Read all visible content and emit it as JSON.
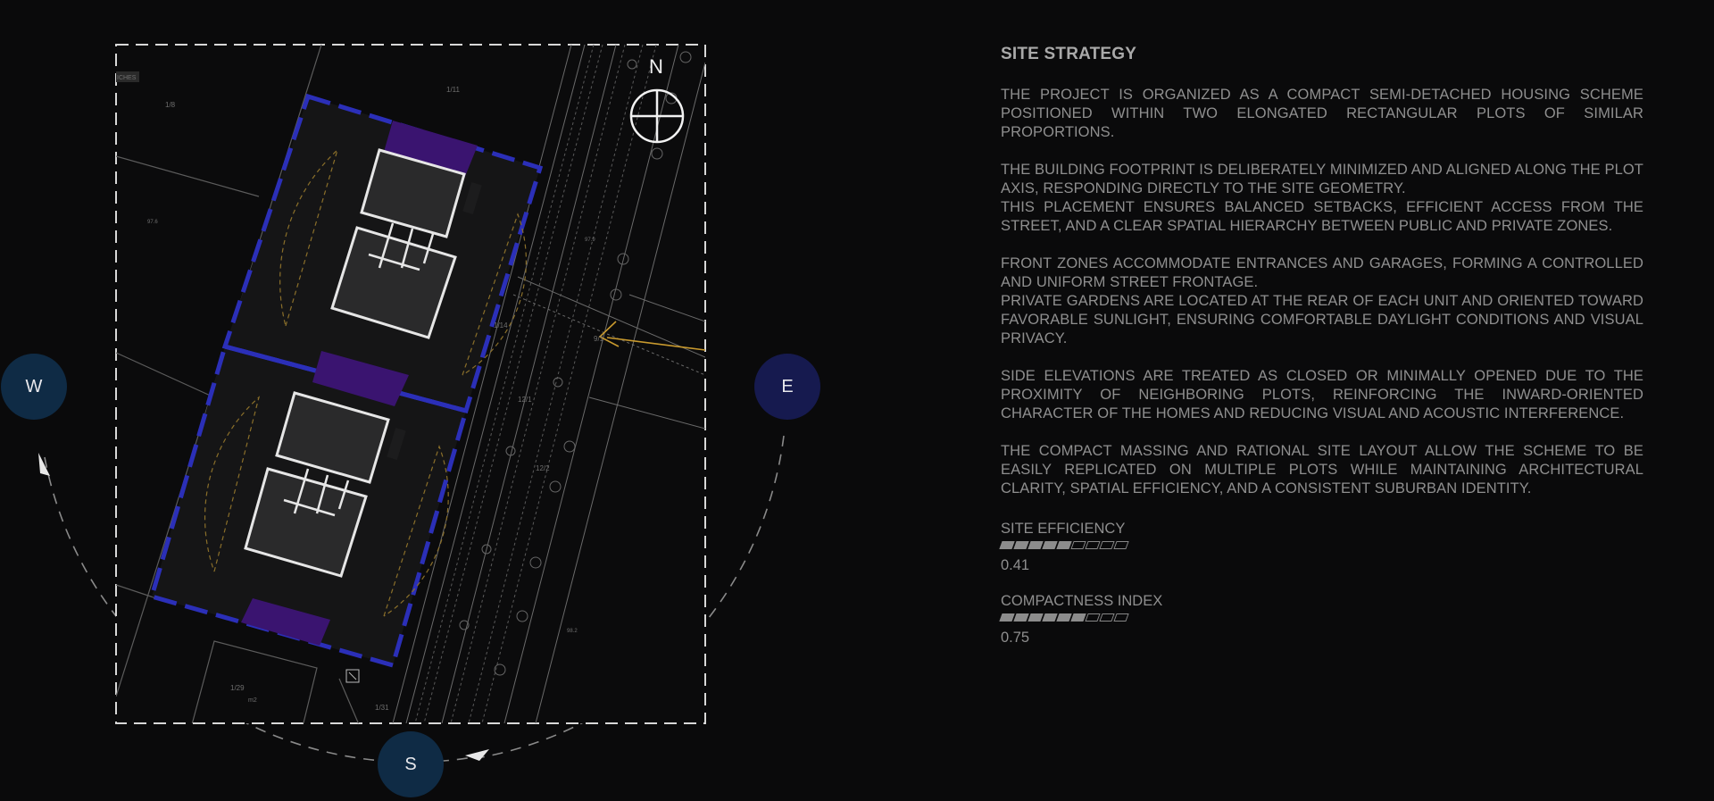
{
  "plan": {
    "north_label": "N",
    "plot_labels": [
      "1/8",
      "1/11",
      "1/14",
      "9/1",
      "12/1",
      "12/2",
      "1/29",
      "1/31"
    ],
    "elevation_labels": [
      "97.6",
      "98.2",
      "97.9"
    ],
    "legend_tag": "ICHES",
    "area_unit": "m2",
    "compass": {
      "west": "W",
      "east": "E",
      "south": "S"
    }
  },
  "panel": {
    "title": "SITE STRATEGY",
    "paragraphs": [
      [
        "THE PROJECT IS ORGANIZED AS A COMPACT SEMI-DETACHED HOUSING SCHEME POSITIONED WITHIN TWO ELONGATED RECTANGULAR PLOTS OF SIMILAR PROPORTIONS."
      ],
      [
        "THE BUILDING FOOTPRINT IS DELIBERATELY MINIMIZED AND ALIGNED ALONG THE PLOT AXIS, RESPONDING DIRECTLY TO THE SITE GEOMETRY.",
        "THIS PLACEMENT ENSURES BALANCED SETBACKS, EFFICIENT ACCESS FROM THE STREET, AND A CLEAR SPATIAL HIERARCHY BETWEEN PUBLIC AND PRIVATE ZONES."
      ],
      [
        "FRONT ZONES ACCOMMODATE ENTRANCES AND GARAGES, FORMING A CONTROLLED AND UNIFORM STREET FRONTAGE.",
        "PRIVATE GARDENS ARE LOCATED AT THE REAR OF EACH UNIT AND ORIENTED TOWARD FAVORABLE SUNLIGHT, ENSURING COMFORTABLE DAYLIGHT CONDITIONS AND VISUAL PRIVACY."
      ],
      [
        "SIDE ELEVATIONS ARE TREATED AS CLOSED OR MINIMALLY OPENED DUE TO THE PROXIMITY OF NEIGHBORING PLOTS, REINFORCING THE INWARD-ORIENTED CHARACTER OF THE HOMES AND REDUCING VISUAL AND ACOUSTIC INTERFERENCE."
      ],
      [
        "THE COMPACT MASSING AND RATIONAL SITE LAYOUT ALLOW THE SCHEME TO BE EASILY REPLICATED ON MULTIPLE PLOTS WHILE MAINTAINING ARCHITECTURAL CLARITY, SPATIAL EFFICIENCY, AND A CONSISTENT SUBURBAN IDENTITY."
      ]
    ],
    "metrics": [
      {
        "label": "SITE EFFICIENCY",
        "value": "0.41",
        "filled": 5,
        "segments": 9
      },
      {
        "label": "COMPACTNESS INDEX",
        "value": "0.75",
        "filled": 6,
        "segments": 9
      }
    ]
  },
  "colors": {
    "background": "#0a0a0b",
    "plot_boundary": "#2b2fb8",
    "entrance_zone": "#3a1470",
    "garden_arcs": "#8a6f2a",
    "access_arrow": "#c99a2e",
    "west_south_button": "#0f2b45",
    "east_button": "#161a4f"
  },
  "icons": [
    "north-arrow-icon",
    "access-arrow-icon",
    "sun-path-arrow-icon"
  ]
}
